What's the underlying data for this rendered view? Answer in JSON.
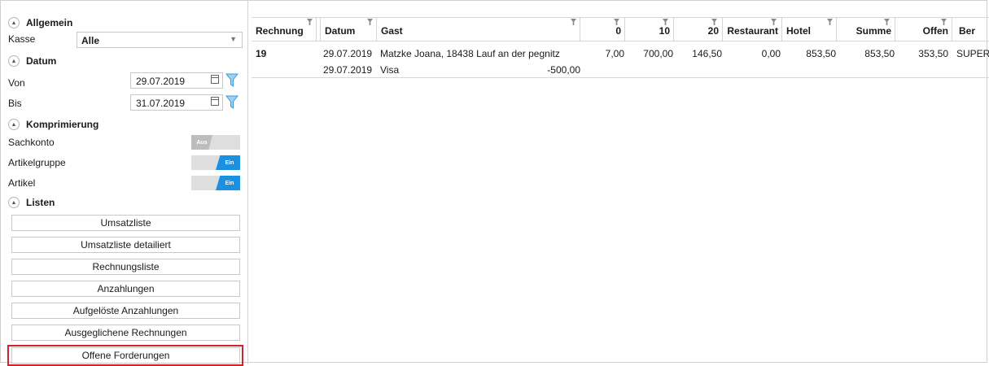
{
  "sections": {
    "allgemein": "Allgemein",
    "datum": "Datum",
    "komprimierung": "Komprimierung",
    "listen": "Listen"
  },
  "collapse_icon": "▲",
  "kasse": {
    "label": "Kasse",
    "value": "Alle",
    "arrow": "▼"
  },
  "von": {
    "label": "Von",
    "value": "29.07.2019"
  },
  "bis": {
    "label": "Bis",
    "value": "31.07.2019"
  },
  "toggles": {
    "sachkonto": {
      "label": "Sachkonto",
      "state": "Aus"
    },
    "artikelgruppe": {
      "label": "Artikelgruppe",
      "state": "Ein"
    },
    "artikel": {
      "label": "Artikel",
      "state": "Ein"
    }
  },
  "lists": [
    "Umsatzliste",
    "Umsatzliste detailiert",
    "Rechnungsliste",
    "Anzahlungen",
    "Aufgelöste Anzahlungen",
    "Ausgeglichene Rechnungen",
    "Offene Forderungen"
  ],
  "colors": {
    "accent": "#1b8fe0",
    "highlight": "#d2232a",
    "funnel": "#3a9ad9"
  },
  "grid": {
    "columns": [
      "Rechnung",
      "Datum",
      "Gast",
      "0",
      "10",
      "20",
      "Restaurant",
      "Hotel",
      "Summe",
      "Offen",
      "Ber"
    ],
    "row": {
      "rechnung": "19",
      "datum": "29.07.2019",
      "gast": "Matzke Joana, 18438 Lauf an der pegnitz",
      "c0": "7,00",
      "c10": "700,00",
      "c20": "146,50",
      "restaurant": "0,00",
      "hotel": "853,50",
      "summe": "853,50",
      "offen": "353,50",
      "ber": "SUPER"
    },
    "payment": {
      "datum": "29.07.2019",
      "text": "Visa",
      "amount": "-500,00"
    }
  }
}
